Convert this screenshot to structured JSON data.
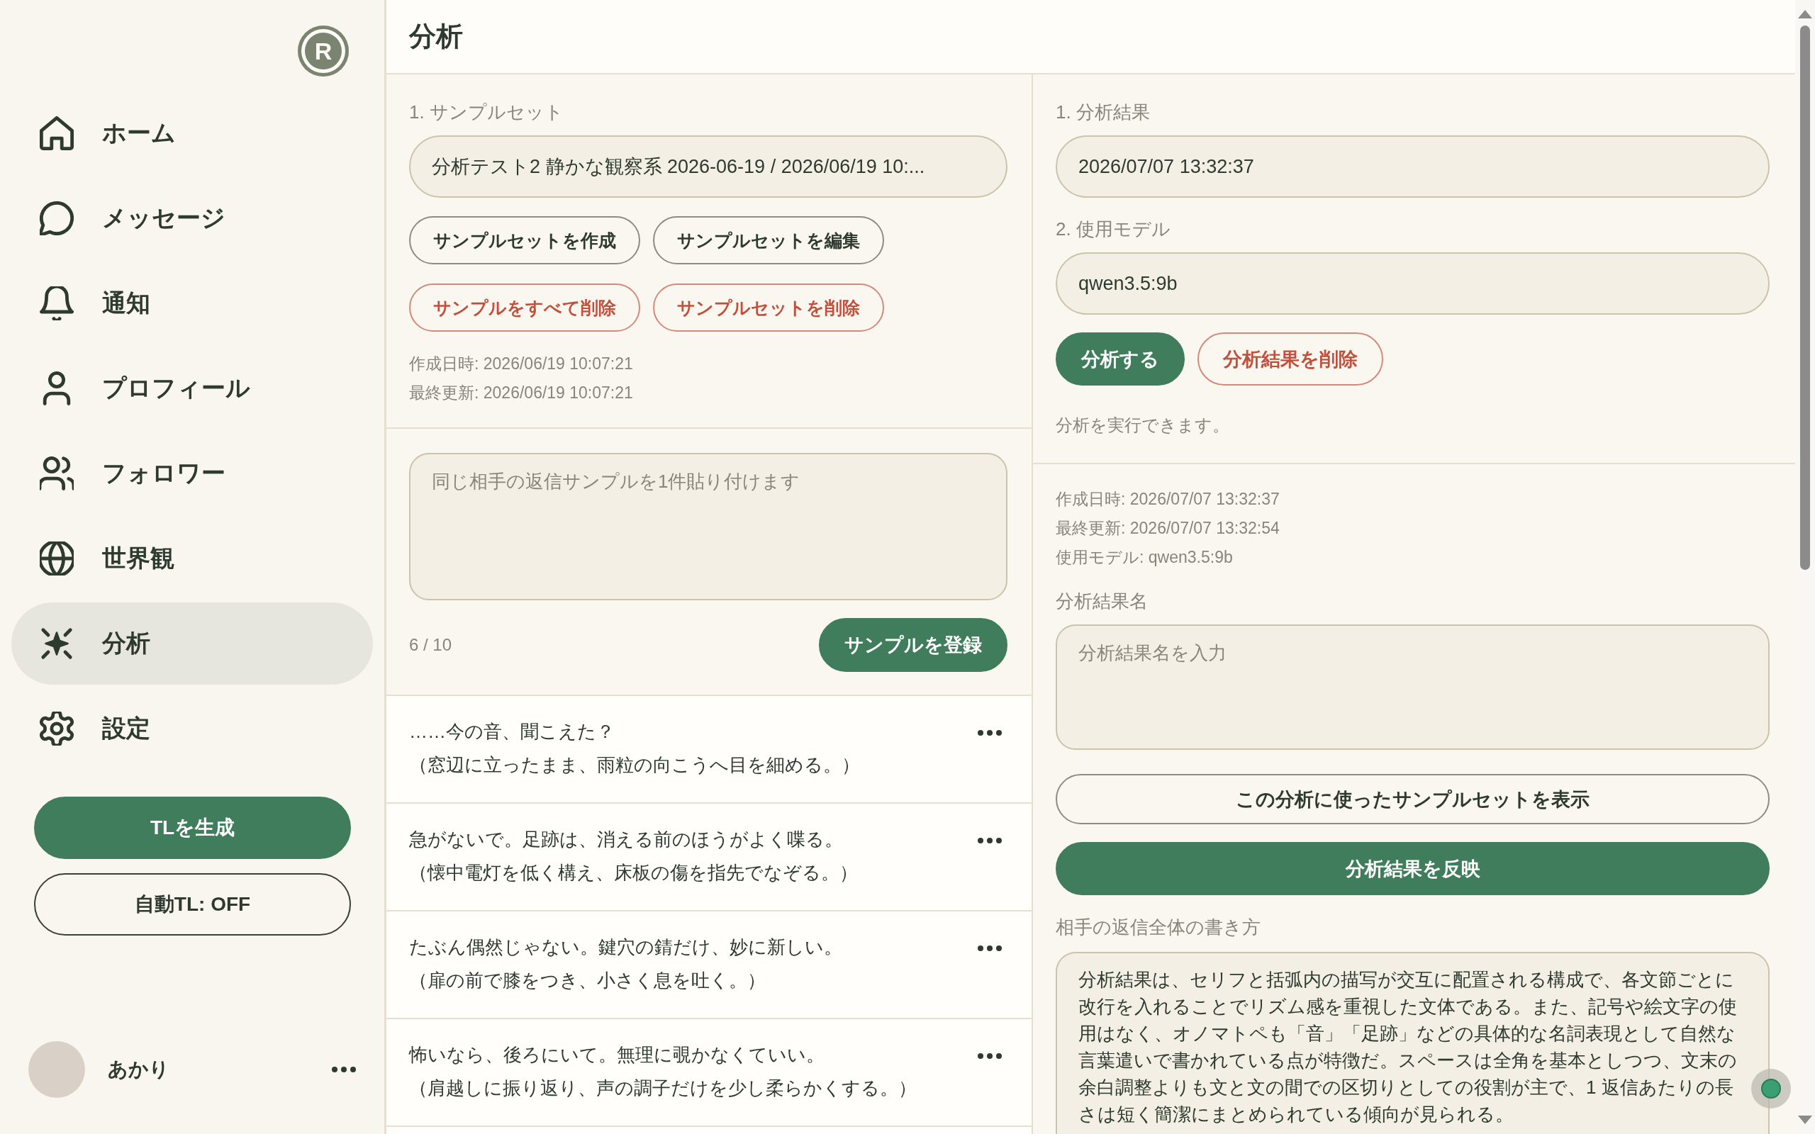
{
  "sidebar": {
    "logo": "R",
    "nav_items": [
      {
        "label": "ホーム",
        "selected": false
      },
      {
        "label": "メッセージ",
        "selected": false
      },
      {
        "label": "通知",
        "selected": false
      },
      {
        "label": "プロフィール",
        "selected": false
      },
      {
        "label": "フォロワー",
        "selected": false
      },
      {
        "label": "世界観",
        "selected": false
      },
      {
        "label": "分析",
        "selected": true
      },
      {
        "label": "設定",
        "selected": false
      }
    ],
    "buttons": [
      {
        "label": "TLを生成",
        "kind": "primary"
      },
      {
        "label": "自動TL: OFF",
        "kind": "outline"
      }
    ],
    "user": {
      "name": "あかり"
    }
  },
  "header": {
    "title": "分析"
  },
  "sample_set": {
    "label": "1. サンプルセット",
    "value": "分析テスト2 静かな観察系 2026-06-19 / 2026/06/19 10:...",
    "actions": [
      {
        "label": "サンプルセットを作成",
        "kind": "outline"
      },
      {
        "label": "サンプルセットを編集",
        "kind": "outline"
      },
      {
        "label": "サンプルをすべて削除",
        "kind": "danger"
      },
      {
        "label": "サンプルセットを削除",
        "kind": "danger"
      }
    ],
    "meta": [
      "作成日時: 2026/06/19 10:07:21",
      "最終更新: 2026/06/19 10:07:21"
    ]
  },
  "sample_input": {
    "placeholder": "同じ相手の返信サンプルを1件貼り付けます",
    "count": "6 / 10",
    "button": {
      "label": "サンプルを登録",
      "kind": "primary"
    }
  },
  "samples": [
    {
      "line": "……今の音、聞こえた？",
      "action": "（窓辺に立ったまま、雨粒の向こうへ目を細める。）"
    },
    {
      "line": "急がないで。足跡は、消える前のほうがよく喋る。",
      "action": "（懐中電灯を低く構え、床板の傷を指先でなぞる。）"
    },
    {
      "line": "たぶん偶然じゃない。鍵穴の錆だけ、妙に新しい。",
      "action": "（扉の前で膝をつき、小さく息を吐く。）"
    },
    {
      "line": "怖いなら、後ろにいて。無理に覗かなくていい。",
      "action": "（肩越しに振り返り、声の調子だけを少し柔らかくする。）"
    }
  ],
  "analysis": {
    "result_label": "1. 分析結果",
    "result_value": "2026/07/07 13:32:37",
    "model_label": "2. 使用モデル",
    "model_value": "qwen3.5:9b",
    "actions": [
      {
        "label": "分析する",
        "kind": "primary"
      },
      {
        "label": "分析結果を削除",
        "kind": "danger"
      }
    ],
    "status": "分析を実行できます。"
  },
  "result_detail": {
    "meta": [
      "作成日時: 2026/07/07 13:32:37",
      "最終更新: 2026/07/07 13:32:54",
      "使用モデル: qwen3.5:9b"
    ],
    "name_label": "分析結果名",
    "name_placeholder": "分析結果名を入力",
    "buttons": [
      {
        "label": "この分析に使ったサンプルセットを表示",
        "kind": "outline"
      },
      {
        "label": "分析結果を反映",
        "kind": "primary"
      }
    ],
    "style_label": "相手の返信全体の書き方",
    "style_text": "分析結果は、セリフと括弧内の描写が交互に配置される構成で、各文節ごとに改行を入れることでリズム感を重視した文体である。また、記号や絵文字の使用はなく、オノマトペも「音」「足跡」などの具体的な名詞表現として自然な言葉遣いで書かれている点が特徴だ。スペースは全角を基本としつつ、文末の余白調整よりも文と文の間での区切りとしての役割が主で、1 返信あたりの長さは短く簡潔にまとめられている傾向が見られる。"
  }
}
